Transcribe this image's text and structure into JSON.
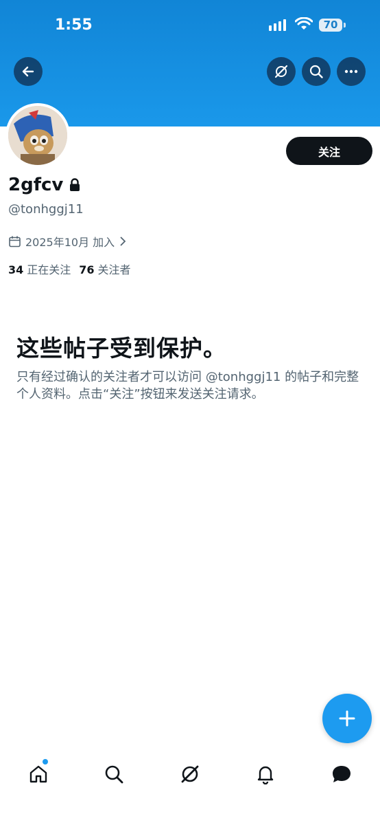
{
  "status_bar": {
    "time": "1:55",
    "battery": "70"
  },
  "header": {
    "icons": [
      "back-arrow-icon",
      "grok-icon",
      "search-icon",
      "more-icon"
    ]
  },
  "profile": {
    "follow_label": "关注",
    "display_name": "2gfcv",
    "handle": "@tonhggj11",
    "joined": "2025年10月 加入",
    "following_count": "34",
    "following_label": "正在关注",
    "followers_count": "76",
    "followers_label": "关注者"
  },
  "protected": {
    "title": "这些帖子受到保护。",
    "body": "只有经过确认的关注者才可以访问 @tonhggj11 的帖子和完整个人资料。点击“关注”按钮来发送关注请求。"
  },
  "tab_bar": {
    "items": [
      "home-icon",
      "search-icon",
      "grok-icon",
      "notifications-icon",
      "messages-icon"
    ]
  },
  "colors": {
    "accent": "#1d9bf0",
    "text": "#0f1419",
    "secondary": "#536471"
  }
}
